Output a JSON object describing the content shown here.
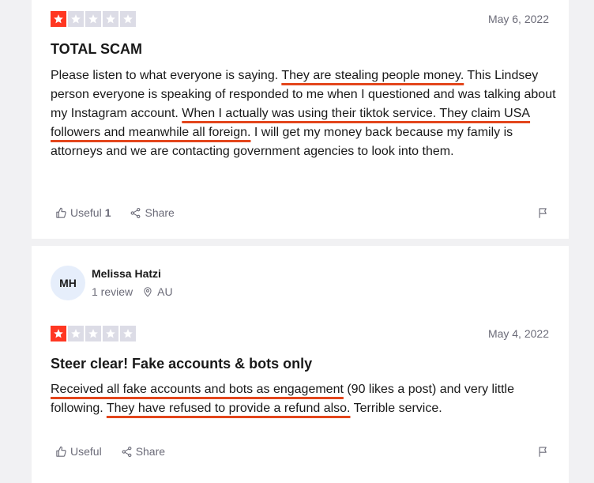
{
  "reviews": [
    {
      "rating": 1,
      "date": "May 6, 2022",
      "title": "TOTAL SCAM",
      "body_parts": [
        "Please listen to what everyone is saying. ",
        "They are stealing people money.",
        " This Lindsey person everyone is speaking of responded to me when I questioned and was talking about my Instagram account. ",
        "When I actually was using their tiktok service. They claim USA followers and meanwhile all foreign.",
        " I will get my money back because my family is attorneys and we are contacting government agencies to look into them."
      ],
      "useful_label": "Useful",
      "useful_count": "1",
      "share_label": "Share"
    },
    {
      "reviewer": {
        "initials": "MH",
        "name": "Melissa Hatzi",
        "reviews": "1 review",
        "country": "AU"
      },
      "rating": 1,
      "date": "May 4, 2022",
      "title": "Steer clear! Fake accounts & bots only",
      "body_parts": [
        "Received all fake accounts and bots as engagement",
        " (90 likes a post) and very little following. ",
        "They have refused to provide a refund also.",
        " Terrible service."
      ],
      "useful_label": "Useful",
      "share_label": "Share"
    }
  ],
  "colors": {
    "star_on": "#ff3722",
    "star_off": "#dcdce6",
    "highlight": "#e3461c",
    "avatar_bg": "#e6eefb"
  },
  "icons": [
    "star-icon",
    "thumbs-up-icon",
    "share-icon",
    "flag-icon",
    "location-pin-icon"
  ]
}
